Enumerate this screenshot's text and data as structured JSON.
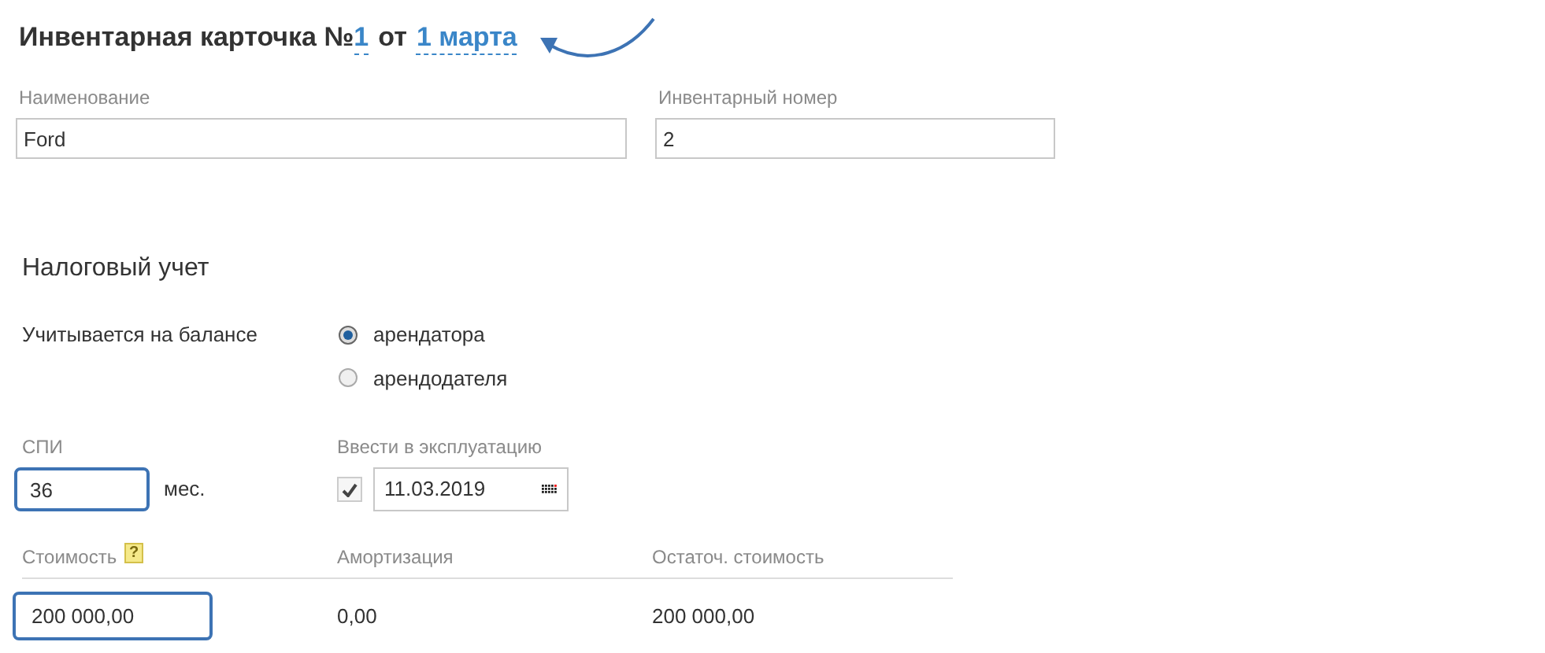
{
  "header": {
    "title": "Инвентарная карточка №",
    "number": "1",
    "separator": "от",
    "date": "1 марта"
  },
  "fields": [
    {
      "label": "Наименование",
      "value": "Ford"
    },
    {
      "label": "Инвентарный номер",
      "value": "2"
    }
  ],
  "section": {
    "title": "Налоговый учет"
  },
  "balance": {
    "label": "Учитывается на балансе",
    "options": [
      {
        "label": "арендатора",
        "selected": true
      },
      {
        "label": "арендодателя",
        "selected": false
      }
    ]
  },
  "life": {
    "label": "СПИ",
    "value": "36",
    "unit": "мес.",
    "focused": true
  },
  "commission": {
    "label": "Ввести в эксплуатацию",
    "checked": true,
    "date": "11.03.2019"
  },
  "cost_table": {
    "columns": [
      {
        "label": "Стоимость",
        "help": "?"
      },
      {
        "label": "Амортизация"
      },
      {
        "label": "Остаточ. стоимость"
      }
    ],
    "row": {
      "cost": "200 000,00",
      "cost_focused": true,
      "depreciation": "0,00",
      "residual": "200 000,00"
    }
  }
}
